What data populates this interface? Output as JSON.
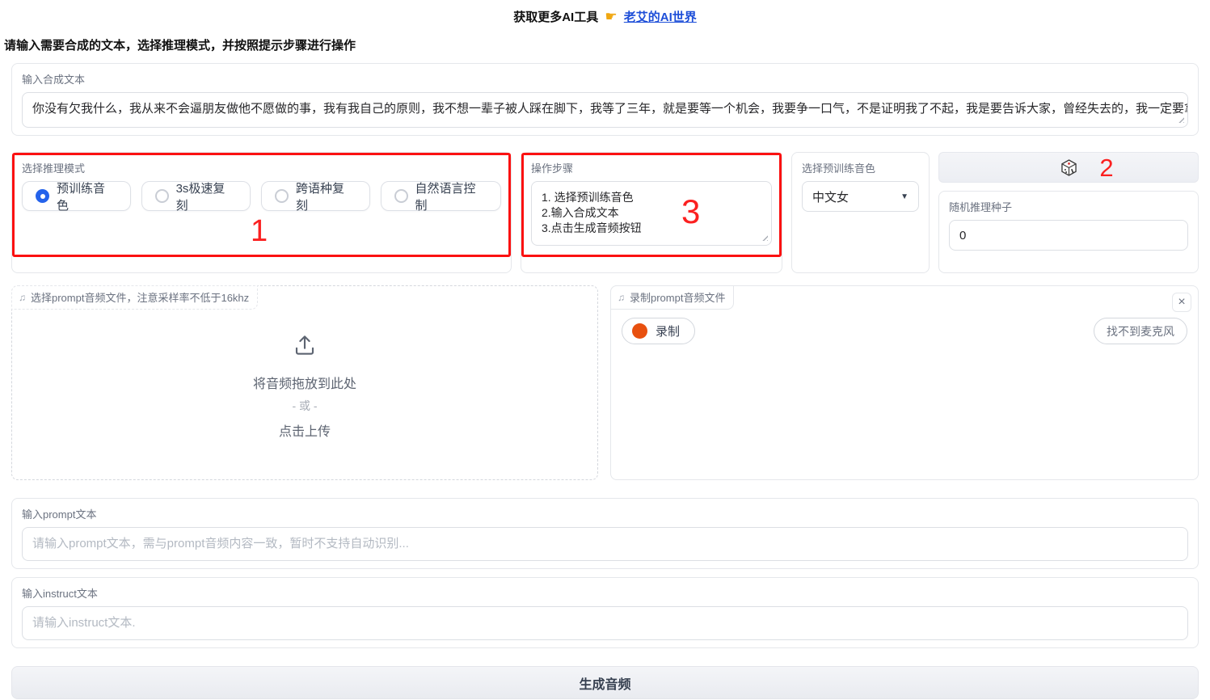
{
  "header": {
    "prefix": "获取更多AI工具",
    "pointer_icon": "☛",
    "link_text": "老艾的AI世界"
  },
  "instruction": "请输入需要合成的文本，选择推理模式，并按照提示步骤进行操作",
  "tts_text": {
    "label": "输入合成文本",
    "value": "你没有欠我什么，我从来不会逼朋友做他不愿做的事，我有我自己的原则，我不想一辈子被人踩在脚下，我等了三年，就是要等一个机会，我要争一口气，不是证明我了不起，我是要告诉大家，曾经失去的，我一定要拿回来。"
  },
  "mode": {
    "label": "选择推理模式",
    "options": [
      "预训练音色",
      "3s极速复刻",
      "跨语种复刻",
      "自然语言控制"
    ],
    "selected": "预训练音色",
    "annotation": "1"
  },
  "steps": {
    "label": "操作步骤",
    "value": "1. 选择预训练音色\n2.输入合成文本\n3.点击生成音频按钮",
    "annotation": "3"
  },
  "voice": {
    "label": "选择预训练音色",
    "selected": "中文女",
    "arrow_icon": "▼"
  },
  "seed": {
    "dice_annotation": "2",
    "label": "随机推理种子",
    "value": "0"
  },
  "upload": {
    "note_icon": "♫",
    "label": "选择prompt音频文件，注意采样率不低于16khz",
    "drop_text": "将音频拖放到此处",
    "or_text": "- 或 -",
    "click_text": "点击上传"
  },
  "record": {
    "note_icon": "♫",
    "label": "录制prompt音频文件",
    "close_icon": "×",
    "record_button": "录制",
    "no_mic_button": "找不到麦克风"
  },
  "prompt_text": {
    "label": "输入prompt文本",
    "placeholder": "请输入prompt文本，需与prompt音频内容一致，暂时不支持自动识别..."
  },
  "instruct_text": {
    "label": "输入instruct文本",
    "placeholder": "请输入instruct文本."
  },
  "generate_button": "生成音频",
  "colors": {
    "annotation_red": "#fb1111",
    "radio_selected_blue": "#2563eb",
    "record_dot_orange": "#e8500f",
    "link_blue": "#1d4ed8",
    "pointer_yellow": "#f0a711"
  }
}
